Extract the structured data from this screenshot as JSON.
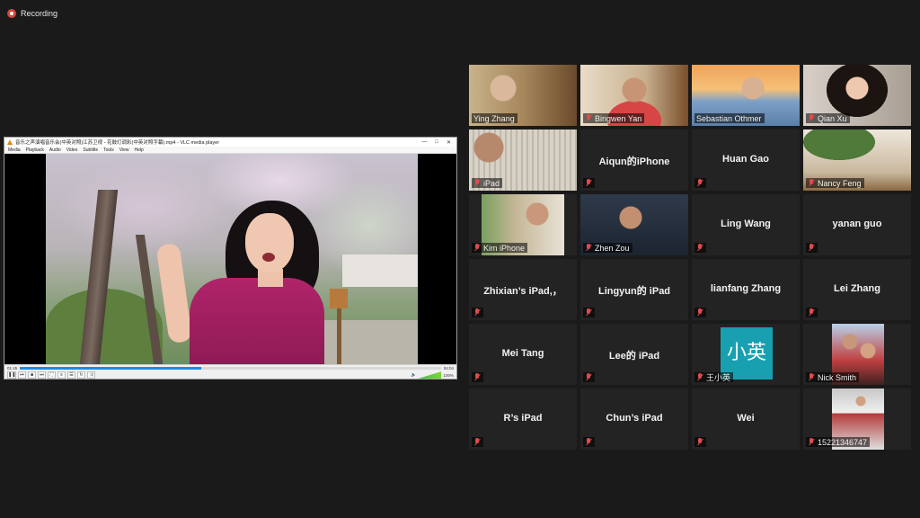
{
  "recording": {
    "label": "Recording"
  },
  "vlc": {
    "title": "音乐之声演唱音乐会(中英对照)江苏卫视 - 花鼓灯调彩(中英对照字幕).mp4 - VLC media player",
    "window_buttons": [
      "—",
      "□",
      "✕"
    ],
    "menu": [
      "Media",
      "Playback",
      "Audio",
      "Video",
      "Subtitle",
      "Tools",
      "View",
      "Help"
    ],
    "time_elapsed": "01:45",
    "time_total": "04:04",
    "progress": 0.43,
    "volume": "100%"
  },
  "participants": [
    {
      "name": "Ying Zhang",
      "video": "v-ying",
      "active": true,
      "muted": false
    },
    {
      "name": "Bingwen Yan",
      "video": "v-bingwen",
      "muted": true
    },
    {
      "name": "Sebastian Othmer",
      "video": "v-sebastian",
      "muted": false
    },
    {
      "name": "Qian Xu",
      "video": "v-qian",
      "muted": true
    },
    {
      "name": "iPad",
      "video": "v-ipad",
      "muted": true
    },
    {
      "name": "Aiqun的iPhone",
      "muted": true,
      "center": true
    },
    {
      "name": "Huan Gao",
      "muted": true,
      "center": true
    },
    {
      "name": "Nancy Feng",
      "video": "v-nancy",
      "muted": true
    },
    {
      "name": "Kim iPhone",
      "video": "v-kim",
      "muted": true
    },
    {
      "name": "Zhen Zou",
      "video": "v-zhen",
      "muted": true
    },
    {
      "name": "Ling Wang",
      "muted": true,
      "center": true
    },
    {
      "name": "yanan guo",
      "muted": true,
      "center": true
    },
    {
      "name": "Zhixian’s iPad,，",
      "muted": true,
      "center": true
    },
    {
      "name": "Lingyun的 iPad",
      "muted": true,
      "center": true
    },
    {
      "name": "lianfang Zhang",
      "muted": true,
      "center": true
    },
    {
      "name": "Lei Zhang",
      "muted": true,
      "center": true
    },
    {
      "name": "Mei Tang",
      "muted": true,
      "center": true
    },
    {
      "name": "Lee的 iPad",
      "muted": true,
      "center": true
    },
    {
      "name": "王小英",
      "video": "v-xiaoying",
      "avatar_text": "小英",
      "muted": true
    },
    {
      "name": "Nick Smith",
      "video": "v-nick",
      "muted": true
    },
    {
      "name": "R’s iPad",
      "muted": true,
      "center": true
    },
    {
      "name": "Chun’s iPad",
      "muted": true,
      "center": true
    },
    {
      "name": "Wei",
      "muted": true,
      "center": true
    },
    {
      "name": "15221346747",
      "video": "v-phone",
      "muted": true
    }
  ]
}
